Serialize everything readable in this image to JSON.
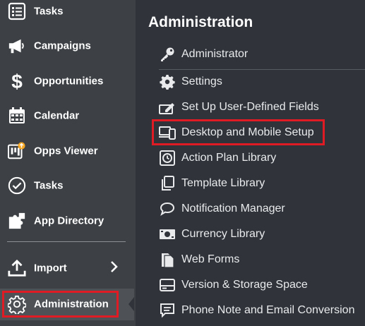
{
  "sidebar": {
    "items": [
      {
        "label": "Tasks",
        "icon": "list-icon"
      },
      {
        "label": "Campaigns",
        "icon": "megaphone-icon"
      },
      {
        "label": "Opportunities",
        "icon": "dollar-icon"
      },
      {
        "label": "Calendar",
        "icon": "calendar-icon"
      },
      {
        "label": "Opps Viewer",
        "icon": "kanban-icon"
      },
      {
        "label": "Tasks",
        "icon": "check-circle-icon"
      },
      {
        "label": "App Directory",
        "icon": "puzzle-icon"
      },
      {
        "label": "Import",
        "icon": "upload-icon"
      },
      {
        "label": "Administration",
        "icon": "gear-icon"
      }
    ]
  },
  "panel": {
    "title": "Administration",
    "items": [
      {
        "label": "Administrator",
        "icon": "key-icon"
      },
      {
        "label": "Settings",
        "icon": "gear-icon"
      },
      {
        "label": "Set Up User-Defined Fields",
        "icon": "edit-field-icon"
      },
      {
        "label": "Desktop and Mobile Setup",
        "icon": "devices-icon"
      },
      {
        "label": "Action Plan Library",
        "icon": "clock-icon"
      },
      {
        "label": "Template Library",
        "icon": "copy-icon"
      },
      {
        "label": "Notification Manager",
        "icon": "chat-bubble-icon"
      },
      {
        "label": "Currency Library",
        "icon": "money-icon"
      },
      {
        "label": "Web Forms",
        "icon": "documents-icon"
      },
      {
        "label": "Version & Storage Space",
        "icon": "storage-icon"
      },
      {
        "label": "Phone Note and Email Conversion",
        "icon": "message-icon"
      }
    ]
  },
  "colors": {
    "sidebar_bg": "#3d4145",
    "panel_bg": "#30343a",
    "highlight": "#e01b24",
    "accent_orange": "#f5a623"
  }
}
